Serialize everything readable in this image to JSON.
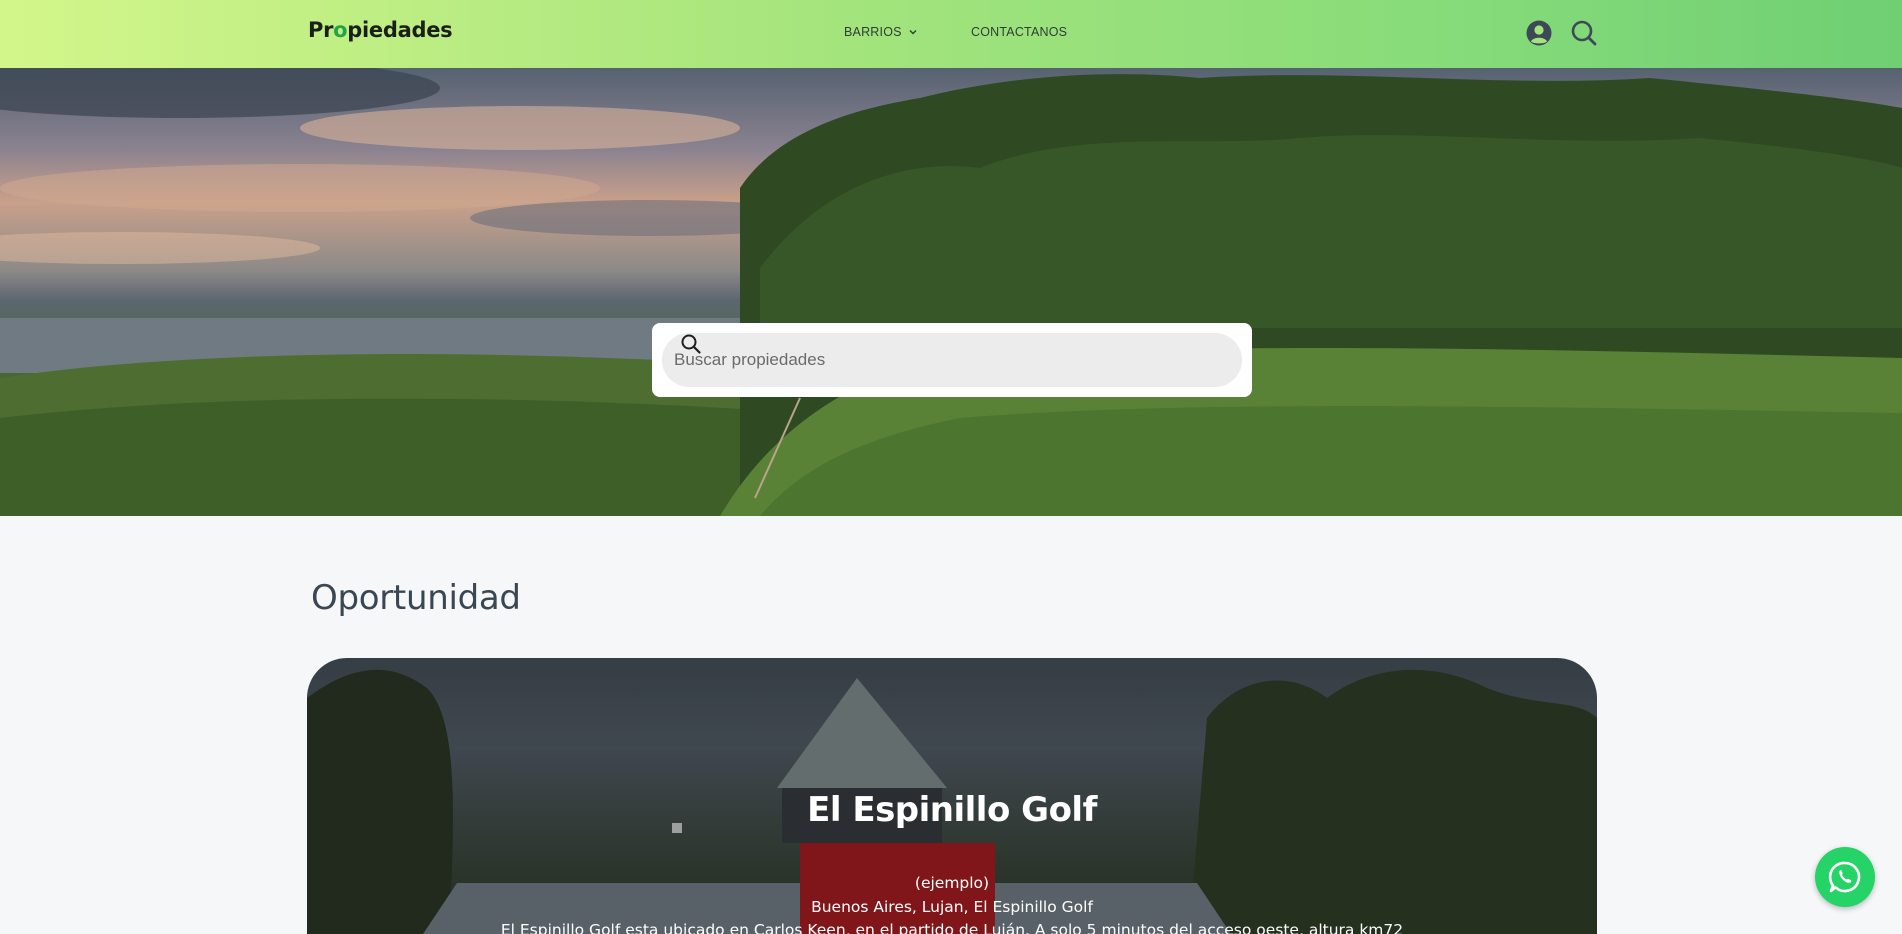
{
  "header": {
    "logo": {
      "before": "Pr",
      "accent": "o",
      "after": "piedades"
    },
    "nav": {
      "barrios": "BARRIOS",
      "contact": "CONTACTANOS"
    },
    "icons": {
      "user": "user-circle-icon",
      "search": "search-icon"
    }
  },
  "hero": {
    "search": {
      "placeholder": "Buscar propiedades",
      "value": ""
    }
  },
  "section": {
    "title": "Oportunidad"
  },
  "featured": {
    "title": "El Espinillo Golf",
    "tag": "(ejemplo)",
    "location": "Buenos Aires, Lujan, El Espinillo Golf",
    "description": "El Espinillo Golf esta ubicado en Carlos Keen, en el partido de Luján. A solo 5 minutos del acceso oeste, altura km72"
  },
  "colors": {
    "accent": "#23a447",
    "whatsapp": "#25d366",
    "header_start": "#d3f68a",
    "header_end": "#6fcf73"
  },
  "floating": {
    "icon": "whatsapp-icon"
  }
}
